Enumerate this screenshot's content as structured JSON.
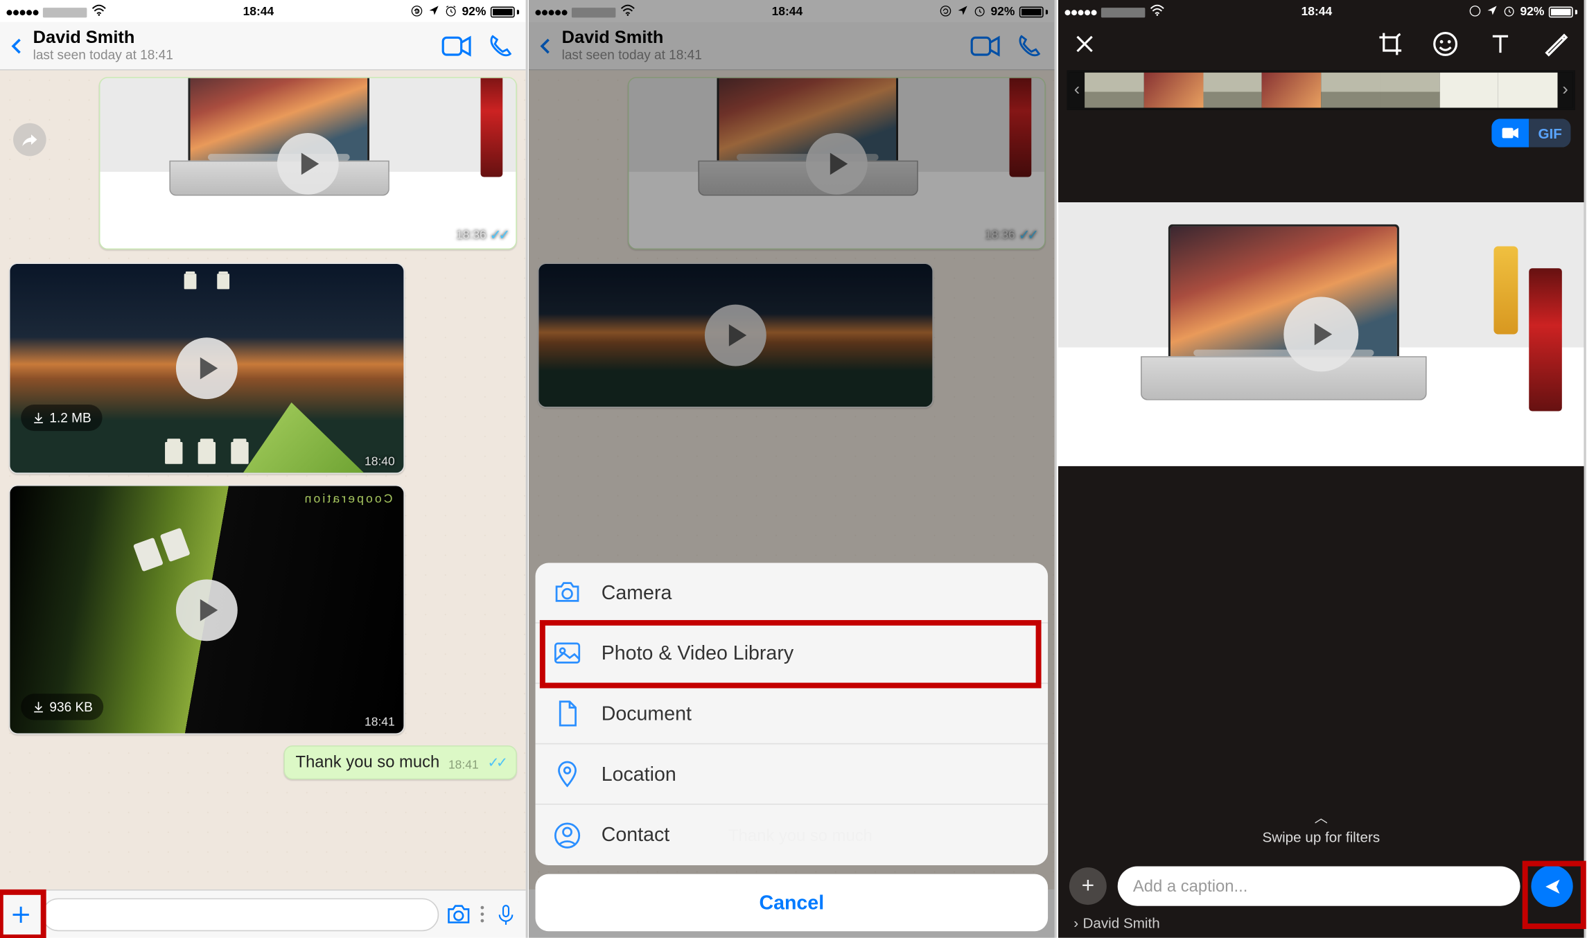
{
  "status": {
    "time": "18:44",
    "battery_pct": "92%",
    "carrier_redacted": true
  },
  "chat": {
    "contact_name": "David Smith",
    "last_seen": "last seen today at 18:41"
  },
  "messages": {
    "video1_time": "18:36",
    "video2_size": "1.2 MB",
    "video2_time": "18:40",
    "video3_size": "936 KB",
    "video3_time": "18:41",
    "video3_label": "Cooperation",
    "thankyou": "Thank you so much",
    "thankyou_time": "18:41"
  },
  "sheet": {
    "camera": "Camera",
    "library": "Photo & Video Library",
    "document": "Document",
    "location": "Location",
    "contact": "Contact",
    "cancel": "Cancel"
  },
  "editor": {
    "gif": "GIF",
    "swipe": "Swipe up for filters",
    "caption_placeholder": "Add a caption...",
    "recipient": "David Smith"
  }
}
